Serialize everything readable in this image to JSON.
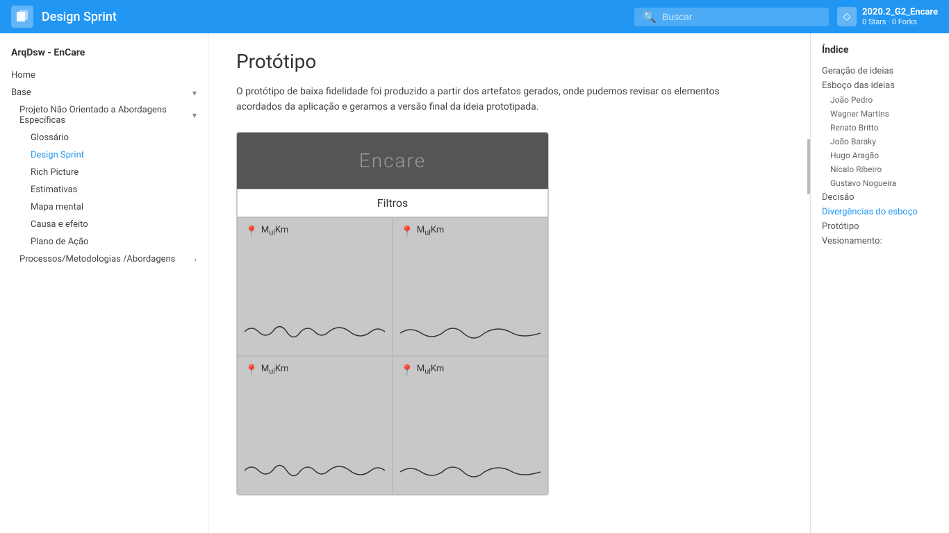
{
  "topnav": {
    "logo_icon": "📘",
    "title": "Design Sprint",
    "search_placeholder": "Buscar",
    "repo_name": "2020.2_G2_Encare",
    "repo_stats": "0 Stars · 0 Forks"
  },
  "sidebar": {
    "project_title": "ArqDsw - EnCare",
    "items": [
      {
        "id": "home",
        "label": "Home",
        "indent": 0,
        "active": false,
        "has_chevron": false
      },
      {
        "id": "base",
        "label": "Base",
        "indent": 0,
        "active": false,
        "has_chevron": true
      },
      {
        "id": "projeto-nao-orientado",
        "label": "Projeto Não Orientado a Abordagens Específicas",
        "indent": 1,
        "active": false,
        "has_chevron": true
      },
      {
        "id": "glossario",
        "label": "Glossário",
        "indent": 2,
        "active": false,
        "has_chevron": false
      },
      {
        "id": "design-sprint",
        "label": "Design Sprint",
        "indent": 2,
        "active": true,
        "has_chevron": false
      },
      {
        "id": "rich-picture",
        "label": "Rich Picture",
        "indent": 2,
        "active": false,
        "has_chevron": false
      },
      {
        "id": "estimativas",
        "label": "Estimativas",
        "indent": 2,
        "active": false,
        "has_chevron": false
      },
      {
        "id": "mapa-mental",
        "label": "Mapa mental",
        "indent": 2,
        "active": false,
        "has_chevron": false
      },
      {
        "id": "causa-efeito",
        "label": "Causa e efeito",
        "indent": 2,
        "active": false,
        "has_chevron": false
      },
      {
        "id": "plano-acao",
        "label": "Plano de Ação",
        "indent": 2,
        "active": false,
        "has_chevron": false
      },
      {
        "id": "processos",
        "label": "Processos/Metodologias /Abordagens",
        "indent": 1,
        "active": false,
        "has_chevron": true
      }
    ]
  },
  "main": {
    "page_title": "Protótipo",
    "description": "O protótipo de baixa fidelidade foi produzido a partir dos artefatos gerados, onde pudemos revisar os elementos acordados da aplicação e geramos a versão final da ideia prototipada.",
    "prototype": {
      "app_name": "Encare",
      "filter_label": "Filtros",
      "cards": [
        {
          "pin": "📍",
          "label": "MᵤₗKm"
        },
        {
          "pin": "📍",
          "label": "MᵤₗKm"
        },
        {
          "pin": "📍",
          "label": "MᵤₗKm"
        },
        {
          "pin": "📍",
          "label": "MᵤₗKm"
        }
      ]
    }
  },
  "right_index": {
    "title": "Índice",
    "items": [
      {
        "id": "geracao-ideias",
        "label": "Geração de ideias",
        "indent": false,
        "active": false
      },
      {
        "id": "esboco-ideias",
        "label": "Esboço das ideias",
        "indent": false,
        "active": false
      },
      {
        "id": "joao-pedro",
        "label": "João Pedro",
        "indent": true,
        "active": false
      },
      {
        "id": "wagner-martins",
        "label": "Wagner Martins",
        "indent": true,
        "active": false
      },
      {
        "id": "renato-britto",
        "label": "Renato Britto",
        "indent": true,
        "active": false
      },
      {
        "id": "joao-baraky",
        "label": "João Baraky",
        "indent": true,
        "active": false
      },
      {
        "id": "hugo-aragao",
        "label": "Hugo Aragão",
        "indent": true,
        "active": false
      },
      {
        "id": "nicalo-ribeiro",
        "label": "Nícalo Ribeiro",
        "indent": true,
        "active": false
      },
      {
        "id": "gustavo-nogueira",
        "label": "Gustavo Nogueira",
        "indent": true,
        "active": false
      },
      {
        "id": "decisao",
        "label": "Decisão",
        "indent": false,
        "active": false
      },
      {
        "id": "divergencias",
        "label": "Divergências do esboço",
        "indent": false,
        "active": true
      },
      {
        "id": "prototipo",
        "label": "Protótipo",
        "indent": false,
        "active": false
      },
      {
        "id": "vesionamento",
        "label": "Vesionamento:",
        "indent": false,
        "active": false
      }
    ]
  }
}
